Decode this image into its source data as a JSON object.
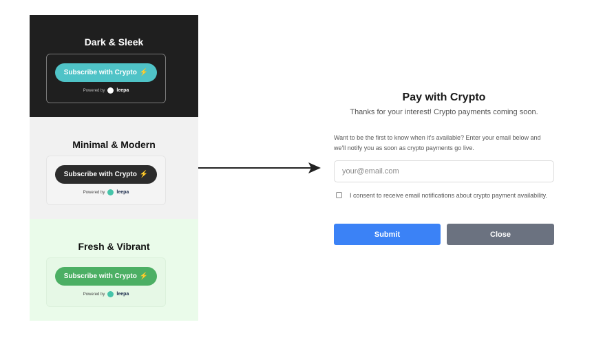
{
  "variants": [
    {
      "title": "Dark & Sleek",
      "button_label": "Subscribe with Crypto",
      "button_icon": "lightning-bolt-icon",
      "powered_by": "Powered by",
      "brand": "leepa",
      "colors": {
        "background": "#1f1f1f",
        "button": "#4fc3c7"
      }
    },
    {
      "title": "Minimal & Modern",
      "button_label": "Subscribe with Crypto",
      "button_icon": "lightning-bolt-icon",
      "powered_by": "Powered by",
      "brand": "leepa",
      "colors": {
        "background": "#f1f1f1",
        "button": "#2c2c2c"
      }
    },
    {
      "title": "Fresh & Vibrant",
      "button_label": "Subscribe with Crypto",
      "button_icon": "lightning-bolt-icon",
      "powered_by": "Powered by",
      "brand": "leepa",
      "colors": {
        "background": "#eafbea",
        "button": "#4caf64"
      }
    }
  ],
  "modal": {
    "title": "Pay with Crypto",
    "subtitle": "Thanks for your interest! Crypto payments coming soon.",
    "description": "Want to be the first to know when it's available? Enter your email below and we'll notify you as soon as crypto payments go live.",
    "email_placeholder": "your@email.com",
    "email_value": "",
    "consent_label": "I consent to receive email notifications about crypto payment availability.",
    "consent_checked": false,
    "submit_label": "Submit",
    "close_label": "Close",
    "colors": {
      "submit": "#3b82f6",
      "close": "#6b7280"
    }
  }
}
